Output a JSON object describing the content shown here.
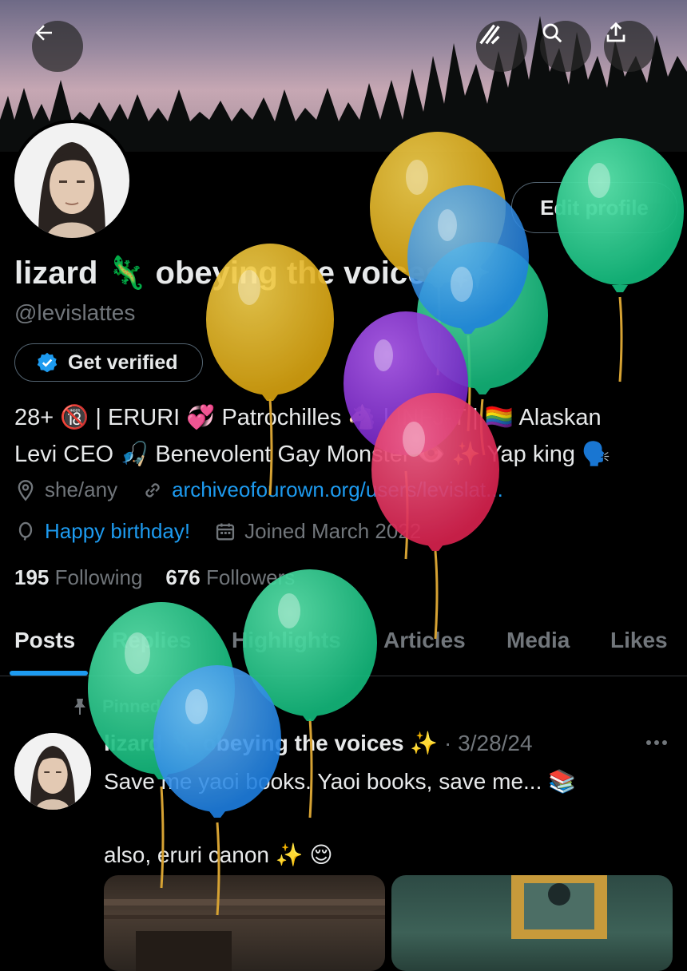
{
  "header": {
    "back_icon": "arrow-left-icon",
    "grok_icon": "grok-icon",
    "search_icon": "search-icon",
    "share_icon": "share-icon"
  },
  "profile": {
    "edit_label": "Edit profile",
    "name": "lizard 🦎 obeying the voices ✨",
    "handle": "@levislattes",
    "verify_label": "Get verified",
    "bio_line1": "28+ 🔞 | ERURI 💞 Patrochilles 🐴 | INFJ-T | 🏳️‍🌈 Alaskan",
    "bio_line2": "Levi CEO 🎣 Benevolent Gay Monster 👁️ ✨ Yap king 🗣️",
    "location": "she/any",
    "website": "archiveofourown.org/users/levislat...",
    "birthday": "Happy birthday!",
    "joined": "Joined March 2022",
    "following_count": "195",
    "following_label": "Following",
    "followers_count": "676",
    "followers_label": "Followers"
  },
  "tabs": [
    "Posts",
    "Replies",
    "Highlights",
    "Articles",
    "Media",
    "Likes"
  ],
  "pinned_post": {
    "pinned_label": "Pinned",
    "author": "lizard 🦎 obeying the voices ✨",
    "date": "· 3/28/24",
    "more_icon": "more-icon",
    "text": "Save me yaoi books. Yaoi books, save me... 📚\n\nalso, eruri canon ✨ 😌"
  },
  "colors": {
    "accent": "#1d9bf0",
    "balloon_yellow": "#e8b31c",
    "balloon_green": "#21c98a",
    "balloon_blue": "#2d8de8",
    "balloon_purple": "#8a2fd6",
    "balloon_red": "#e5335c"
  }
}
